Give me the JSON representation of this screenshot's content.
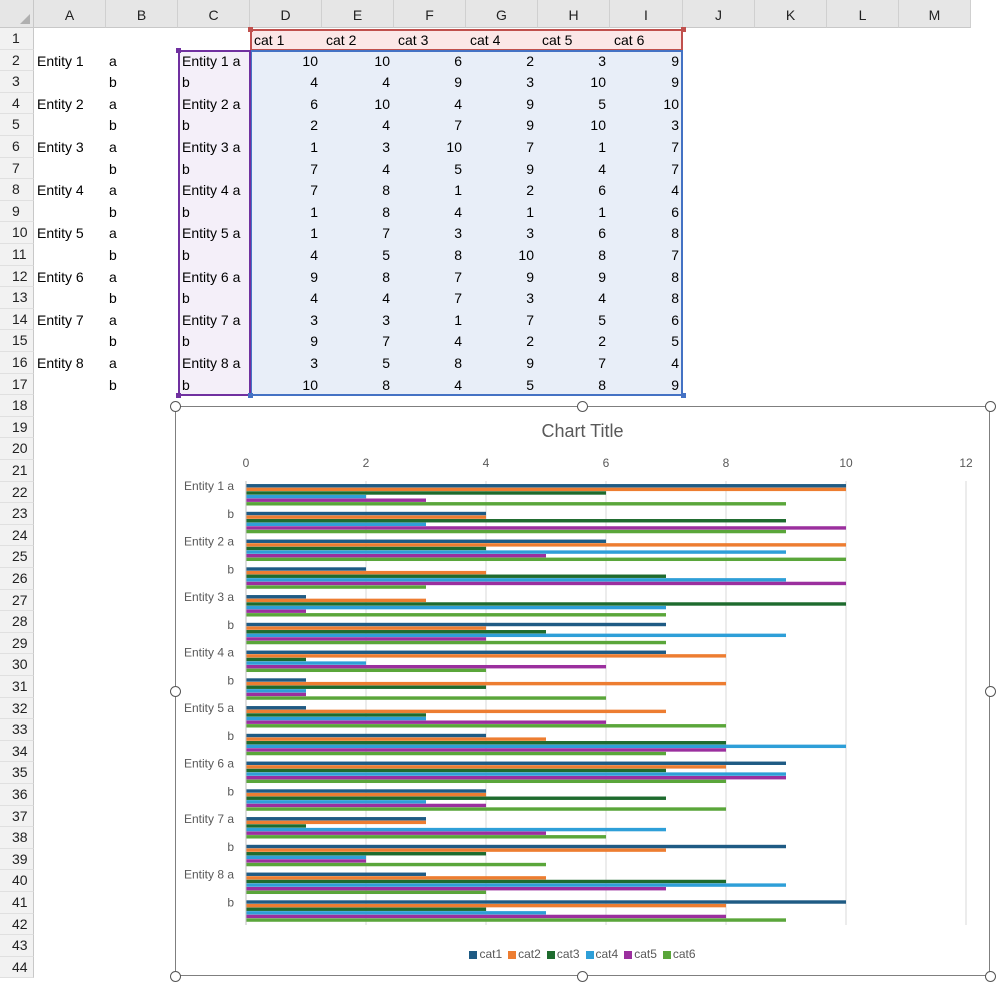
{
  "columns": [
    "A",
    "B",
    "C",
    "D",
    "E",
    "F",
    "G",
    "H",
    "I",
    "J",
    "K",
    "L",
    "M"
  ],
  "rows": [
    "1",
    "2",
    "3",
    "4",
    "5",
    "6",
    "7",
    "8",
    "9",
    "10",
    "11",
    "12",
    "13",
    "14",
    "15",
    "16",
    "17",
    "18",
    "19",
    "20",
    "21",
    "22",
    "23",
    "24",
    "25",
    "26",
    "27",
    "28",
    "29",
    "30",
    "31",
    "32",
    "33",
    "34",
    "35",
    "36",
    "37",
    "38",
    "39",
    "40",
    "41",
    "42",
    "43",
    "44"
  ],
  "headers": [
    "cat 1",
    "cat 2",
    "cat 3",
    "cat 4",
    "cat 5",
    "cat 6"
  ],
  "table": [
    {
      "a": "Entity 1",
      "b": "a",
      "c": "Entity 1 a",
      "vals": [
        10,
        10,
        6,
        2,
        3,
        9
      ]
    },
    {
      "a": "",
      "b": "b",
      "c": "b",
      "vals": [
        4,
        4,
        9,
        3,
        10,
        9
      ]
    },
    {
      "a": "Entity 2",
      "b": "a",
      "c": "Entity 2 a",
      "vals": [
        6,
        10,
        4,
        9,
        5,
        10
      ]
    },
    {
      "a": "",
      "b": "b",
      "c": "b",
      "vals": [
        2,
        4,
        7,
        9,
        10,
        3
      ]
    },
    {
      "a": "Entity 3",
      "b": "a",
      "c": "Entity 3 a",
      "vals": [
        1,
        3,
        10,
        7,
        1,
        7
      ]
    },
    {
      "a": "",
      "b": "b",
      "c": "b",
      "vals": [
        7,
        4,
        5,
        9,
        4,
        7
      ]
    },
    {
      "a": "Entity 4",
      "b": "a",
      "c": "Entity 4 a",
      "vals": [
        7,
        8,
        1,
        2,
        6,
        4
      ]
    },
    {
      "a": "",
      "b": "b",
      "c": "b",
      "vals": [
        1,
        8,
        4,
        1,
        1,
        6
      ]
    },
    {
      "a": "Entity 5",
      "b": "a",
      "c": "Entity 5 a",
      "vals": [
        1,
        7,
        3,
        3,
        6,
        8
      ]
    },
    {
      "a": "",
      "b": "b",
      "c": "b",
      "vals": [
        4,
        5,
        8,
        10,
        8,
        7
      ]
    },
    {
      "a": "Entity 6",
      "b": "a",
      "c": "Entity 6 a",
      "vals": [
        9,
        8,
        7,
        9,
        9,
        8
      ]
    },
    {
      "a": "",
      "b": "b",
      "c": "b",
      "vals": [
        4,
        4,
        7,
        3,
        4,
        8
      ]
    },
    {
      "a": "Entity 7",
      "b": "a",
      "c": "Entity 7 a",
      "vals": [
        3,
        3,
        1,
        7,
        5,
        6
      ]
    },
    {
      "a": "",
      "b": "b",
      "c": "b",
      "vals": [
        9,
        7,
        4,
        2,
        2,
        5
      ]
    },
    {
      "a": "Entity 8",
      "b": "a",
      "c": "Entity 8 a",
      "vals": [
        3,
        5,
        8,
        9,
        7,
        4
      ]
    },
    {
      "a": "",
      "b": "b",
      "c": "b",
      "vals": [
        10,
        8,
        4,
        5,
        8,
        9
      ]
    }
  ],
  "chart_data": {
    "type": "bar",
    "orientation": "horizontal",
    "title": "Chart Title",
    "categories": [
      "Entity 1 a",
      "b",
      "Entity 2 a",
      "b",
      "Entity 3 a",
      "b",
      "Entity 4 a",
      "b",
      "Entity 5 a",
      "b",
      "Entity 6 a",
      "b",
      "Entity 7 a",
      "b",
      "Entity 8 a",
      "b"
    ],
    "xlim": [
      0,
      12
    ],
    "xticks": [
      "0",
      "2",
      "4",
      "6",
      "8",
      "10",
      "12"
    ],
    "grid": true,
    "legend_position": "bottom",
    "series": [
      {
        "name": "cat1",
        "color": "#1f5b84",
        "values": [
          10,
          4,
          6,
          2,
          1,
          7,
          7,
          1,
          1,
          4,
          9,
          4,
          3,
          9,
          3,
          10
        ]
      },
      {
        "name": "cat2",
        "color": "#ed7d31",
        "values": [
          10,
          4,
          10,
          4,
          3,
          4,
          8,
          8,
          7,
          5,
          8,
          4,
          3,
          7,
          5,
          8
        ]
      },
      {
        "name": "cat3",
        "color": "#1e6b2e",
        "values": [
          6,
          9,
          4,
          7,
          10,
          5,
          1,
          4,
          3,
          8,
          7,
          7,
          1,
          4,
          8,
          4
        ]
      },
      {
        "name": "cat4",
        "color": "#2e9fd8",
        "values": [
          2,
          3,
          9,
          9,
          7,
          9,
          2,
          1,
          3,
          10,
          9,
          3,
          7,
          2,
          9,
          5
        ]
      },
      {
        "name": "cat5",
        "color": "#9b2f9e",
        "values": [
          3,
          10,
          5,
          10,
          1,
          4,
          6,
          1,
          6,
          8,
          9,
          4,
          5,
          2,
          7,
          8
        ]
      },
      {
        "name": "cat6",
        "color": "#5aa63a",
        "values": [
          9,
          9,
          10,
          3,
          7,
          7,
          4,
          6,
          8,
          7,
          8,
          8,
          6,
          5,
          4,
          9
        ]
      }
    ]
  }
}
